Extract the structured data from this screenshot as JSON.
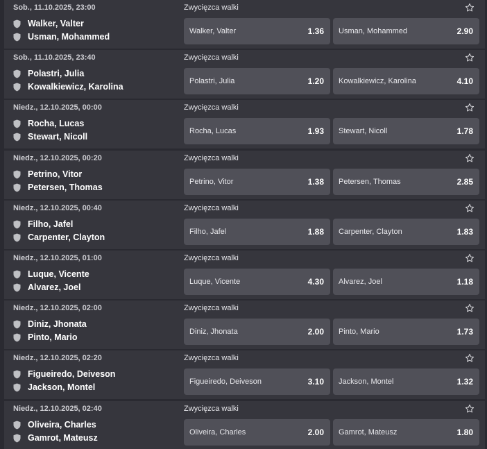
{
  "events": [
    {
      "date": "Sob., 11.10.2025, 23:00",
      "market": "Zwycięzca walki",
      "f1": "Walker, Valter",
      "f2": "Usman, Mohammed",
      "o1": "1.36",
      "o2": "2.90"
    },
    {
      "date": "Sob., 11.10.2025, 23:40",
      "market": "Zwycięzca walki",
      "f1": "Polastri, Julia",
      "f2": "Kowalkiewicz, Karolina",
      "o1": "1.20",
      "o2": "4.10"
    },
    {
      "date": "Niedz., 12.10.2025, 00:00",
      "market": "Zwycięzca walki",
      "f1": "Rocha, Lucas",
      "f2": "Stewart, Nicoll",
      "o1": "1.93",
      "o2": "1.78"
    },
    {
      "date": "Niedz., 12.10.2025, 00:20",
      "market": "Zwycięzca walki",
      "f1": "Petrino, Vitor",
      "f2": "Petersen, Thomas",
      "o1": "1.38",
      "o2": "2.85"
    },
    {
      "date": "Niedz., 12.10.2025, 00:40",
      "market": "Zwycięzca walki",
      "f1": "Filho, Jafel",
      "f2": "Carpenter, Clayton",
      "o1": "1.88",
      "o2": "1.83"
    },
    {
      "date": "Niedz., 12.10.2025, 01:00",
      "market": "Zwycięzca walki",
      "f1": "Luque, Vicente",
      "f2": "Alvarez, Joel",
      "o1": "4.30",
      "o2": "1.18"
    },
    {
      "date": "Niedz., 12.10.2025, 02:00",
      "market": "Zwycięzca walki",
      "f1": "Diniz, Jhonata",
      "f2": "Pinto, Mario",
      "o1": "2.00",
      "o2": "1.73"
    },
    {
      "date": "Niedz., 12.10.2025, 02:20",
      "market": "Zwycięzca walki",
      "f1": "Figueiredo, Deiveson",
      "f2": "Jackson, Montel",
      "o1": "3.10",
      "o2": "1.32"
    },
    {
      "date": "Niedz., 12.10.2025, 02:40",
      "market": "Zwycięzca walki",
      "f1": "Oliveira, Charles",
      "f2": "Gamrot, Mateusz",
      "o1": "2.00",
      "o2": "1.80"
    }
  ]
}
